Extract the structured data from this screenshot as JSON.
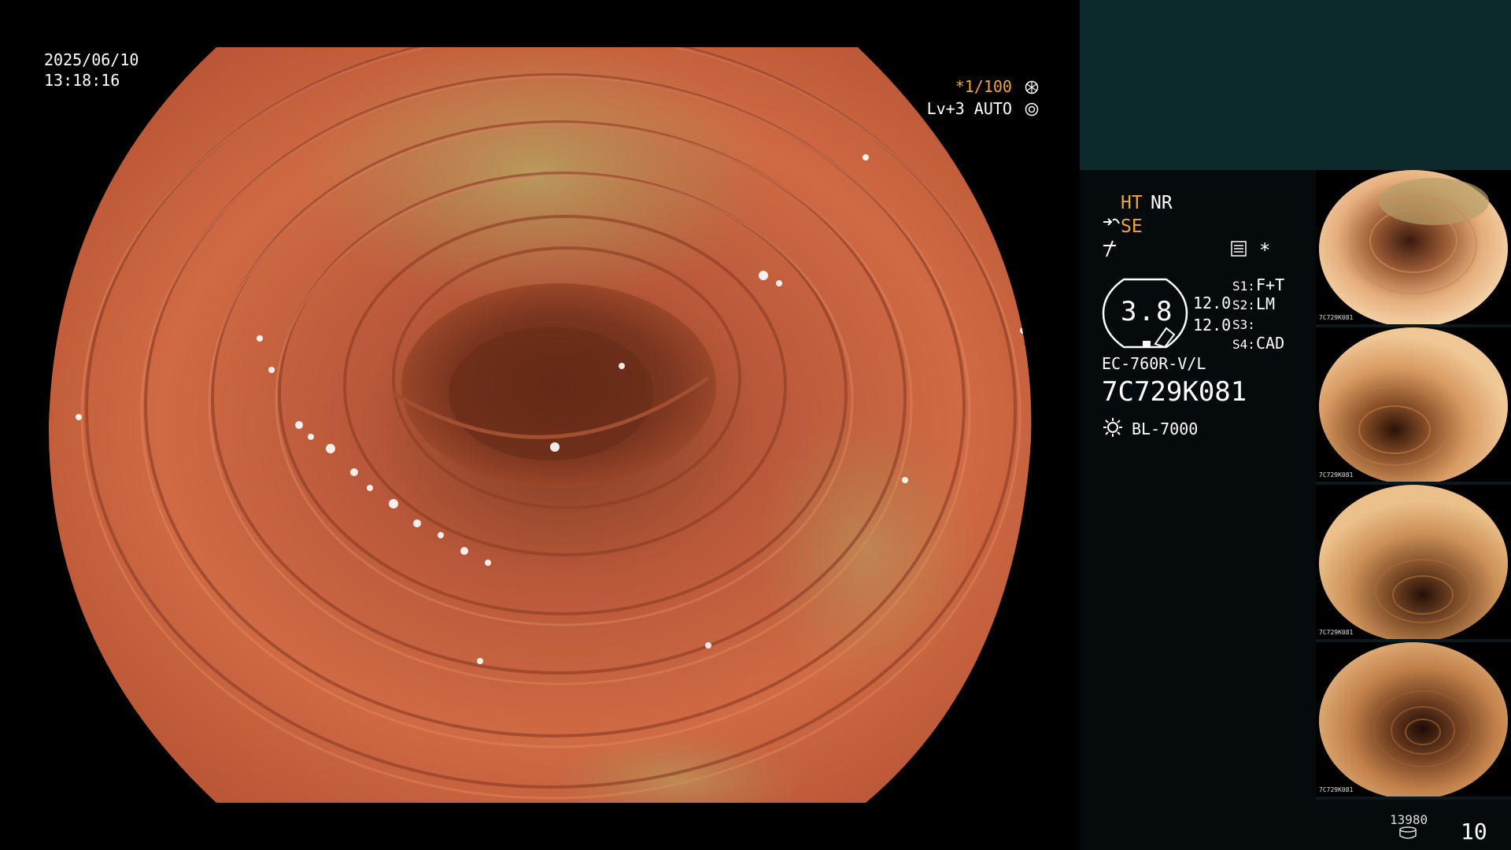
{
  "overlay": {
    "date": "2025/06/10",
    "time": "13:18:16",
    "exposure": "*1/100",
    "level": "Lv+3 AUTO"
  },
  "panel": {
    "ht": "HT",
    "nr": "NR",
    "se": "SE",
    "asterisk": "*",
    "zoom": "3.8",
    "gain_top": "12.0",
    "gain_bottom": "12.0",
    "slots": [
      {
        "label": "S1:",
        "value": "F+T"
      },
      {
        "label": "S2:",
        "value": "LM"
      },
      {
        "label": "S3:",
        "value": ""
      },
      {
        "label": "S4:",
        "value": "CAD"
      }
    ],
    "scope_model": "EC-760R-V/L",
    "scope_serial": "7C729K081",
    "light_source": "BL-7000",
    "storage_count": "13980",
    "image_count": "10"
  },
  "thumbnails": [
    {
      "tag": "7C729K081"
    },
    {
      "tag": "7C729K081"
    },
    {
      "tag": "7C729K081"
    },
    {
      "tag": "7C729K081"
    }
  ],
  "colors": {
    "accent_orange": "#f2a43a",
    "panel_teal": "#0c2a2c",
    "tissue": "#c9663e"
  }
}
